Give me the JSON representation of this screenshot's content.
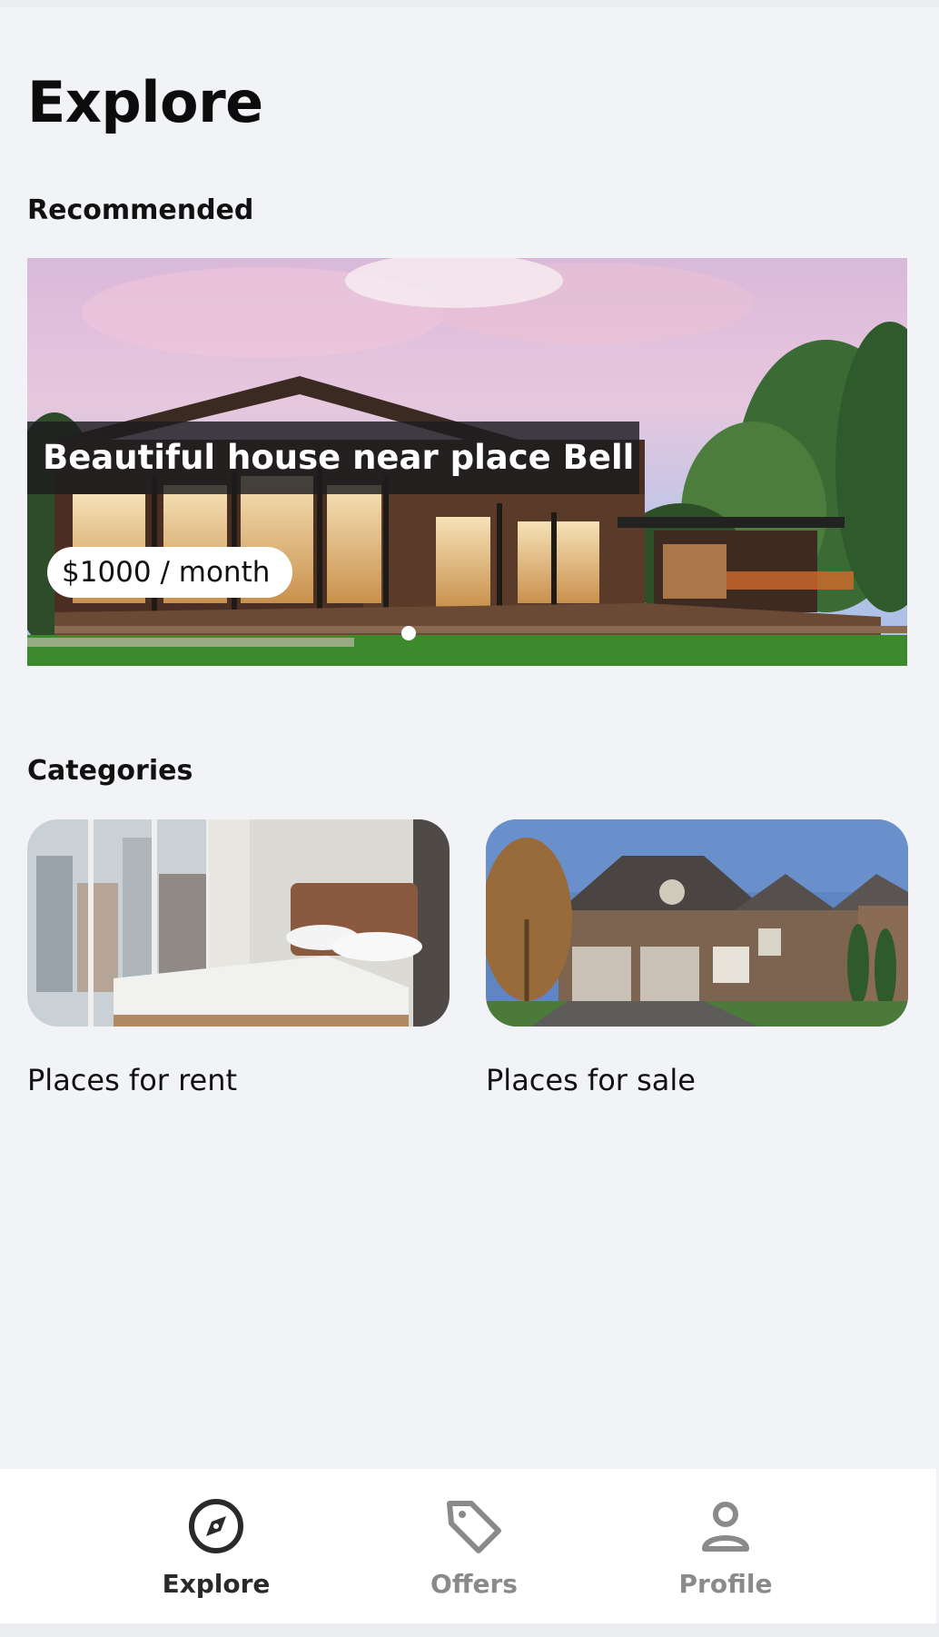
{
  "page": {
    "title": "Explore"
  },
  "recommended": {
    "title": "Recommended",
    "featured": {
      "caption": "Beautiful house near place Bell",
      "price": "$1000 / month"
    },
    "carousel": {
      "slide_count": 1,
      "active_index": 0
    }
  },
  "categories": {
    "title": "Categories",
    "items": [
      {
        "label": "Places for rent",
        "image": "bedroom-photo"
      },
      {
        "label": "Places for sale",
        "image": "brick-house-photo"
      }
    ]
  },
  "bottom_nav": {
    "items": [
      {
        "label": "Explore",
        "icon": "compass-icon",
        "active": true
      },
      {
        "label": "Offers",
        "icon": "tag-icon",
        "active": false
      },
      {
        "label": "Profile",
        "icon": "person-icon",
        "active": false
      }
    ]
  },
  "colors": {
    "background": "#f2f3f7",
    "active_nav": "#2a2a2a",
    "inactive_nav": "#8a8a8a",
    "caption_overlay": "#1c1c1e"
  }
}
